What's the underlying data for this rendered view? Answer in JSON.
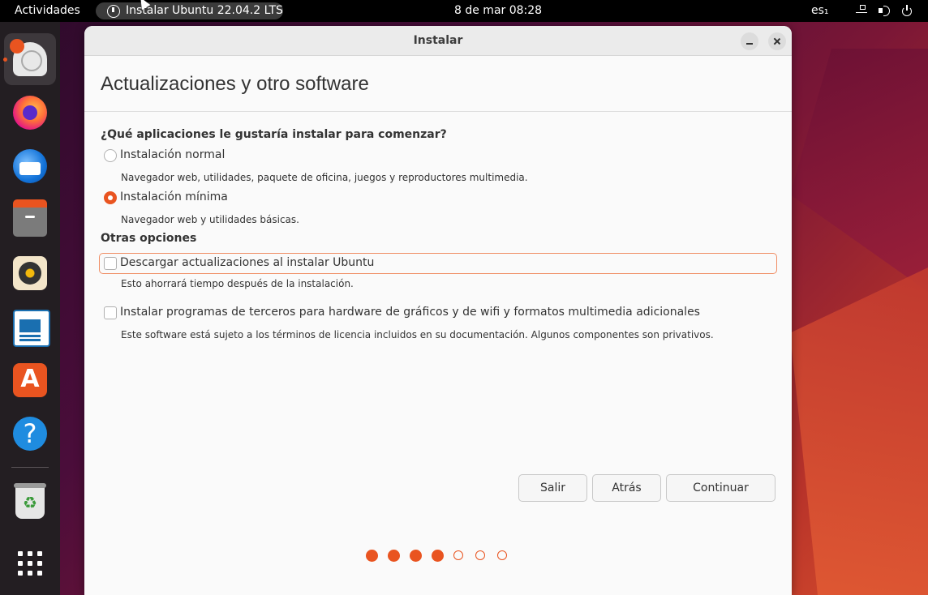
{
  "topbar": {
    "activities": "Actividades",
    "app_name": "Instalar Ubuntu 22.04.2 LTS",
    "clock": "8 de mar  08:28",
    "lang": "es₁"
  },
  "dock": {
    "items": [
      "ubuntu-installer",
      "firefox",
      "thunderbird",
      "files",
      "rhythmbox",
      "libreoffice-writer",
      "ubuntu-software",
      "help",
      "trash",
      "show-apps"
    ]
  },
  "window": {
    "title": "Instalar",
    "heading": "Actualizaciones y otro software",
    "question": "¿Qué aplicaciones le gustaría instalar para comenzar?",
    "options": {
      "normal": {
        "label": "Instalación normal",
        "desc": "Navegador web, utilidades, paquete de oficina, juegos y reproductores multimedia.",
        "checked": false
      },
      "minimal": {
        "label": "Instalación mínima",
        "desc": "Navegador web y utilidades básicas.",
        "checked": true
      }
    },
    "other_title": "Otras opciones",
    "other": {
      "updates": {
        "label": "Descargar actualizaciones al instalar Ubuntu",
        "desc": "Esto ahorrará tiempo después de la instalación.",
        "checked": false
      },
      "third_party": {
        "label": "Instalar programas de terceros para hardware de gráficos y de wifi y formatos multimedia adicionales",
        "desc": "Este software está sujeto a los términos de licencia incluidos en su documentación. Algunos componentes son privativos.",
        "checked": false
      }
    },
    "buttons": {
      "quit": "Salir",
      "back": "Atrás",
      "continue": "Continuar"
    },
    "progress": {
      "current_step": 4,
      "total_steps": 7
    }
  },
  "colors": {
    "accent": "#e95420",
    "dock_bg": "#231e22",
    "topbar_bg": "#000000"
  }
}
